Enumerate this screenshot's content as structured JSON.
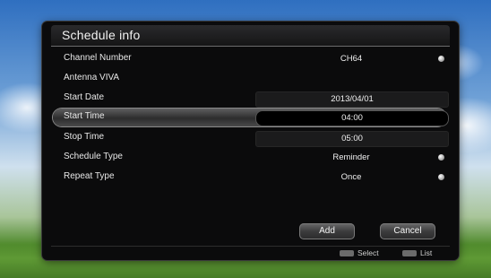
{
  "title": "Schedule info",
  "rows": [
    {
      "label": "Channel Number",
      "value": "CH64",
      "has_arrow": true
    },
    {
      "label": "Antenna VIVA",
      "value": "",
      "has_arrow": false
    },
    {
      "label": "Start Date",
      "value": "2013/04/01",
      "has_arrow": false
    },
    {
      "label": "Start Time",
      "value": "04:00",
      "has_arrow": false,
      "selected": true
    },
    {
      "label": "Stop Time",
      "value": "05:00",
      "has_arrow": false
    },
    {
      "label": "Schedule Type",
      "value": "Reminder",
      "has_arrow": true
    },
    {
      "label": "Repeat Type",
      "value": "Once",
      "has_arrow": true
    }
  ],
  "buttons": {
    "add": "Add",
    "cancel": "Cancel"
  },
  "hints": {
    "select": "Select",
    "list": "List"
  }
}
